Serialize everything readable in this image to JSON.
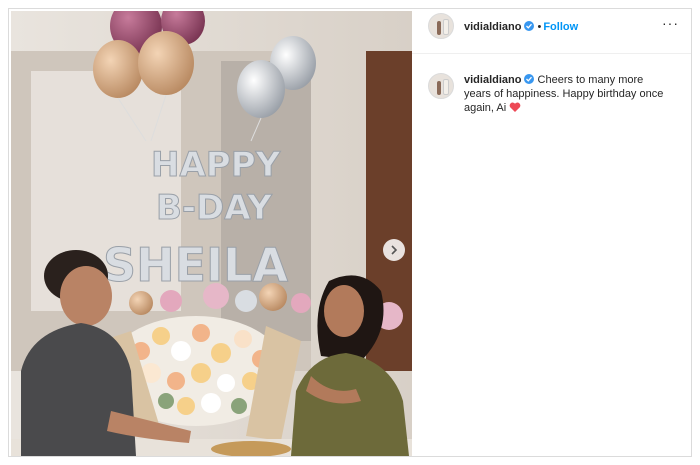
{
  "post": {
    "username": "vidialdiano",
    "verified": true,
    "follow_separator": "•",
    "follow_label": "Follow",
    "more_label": "···",
    "caption_text": "Cheers to many more years of happiness. Happy birthday once again, Ai",
    "caption_emoji": "red-heart-icon",
    "balloon_text_line1": "HAPPY",
    "balloon_text_line2": "B-DAY",
    "balloon_text_line3": "SHEILA"
  },
  "colors": {
    "verified_blue": "#3897f0",
    "follow_blue": "#0095f6",
    "heart_red": "#ed4956",
    "text": "#262626"
  }
}
